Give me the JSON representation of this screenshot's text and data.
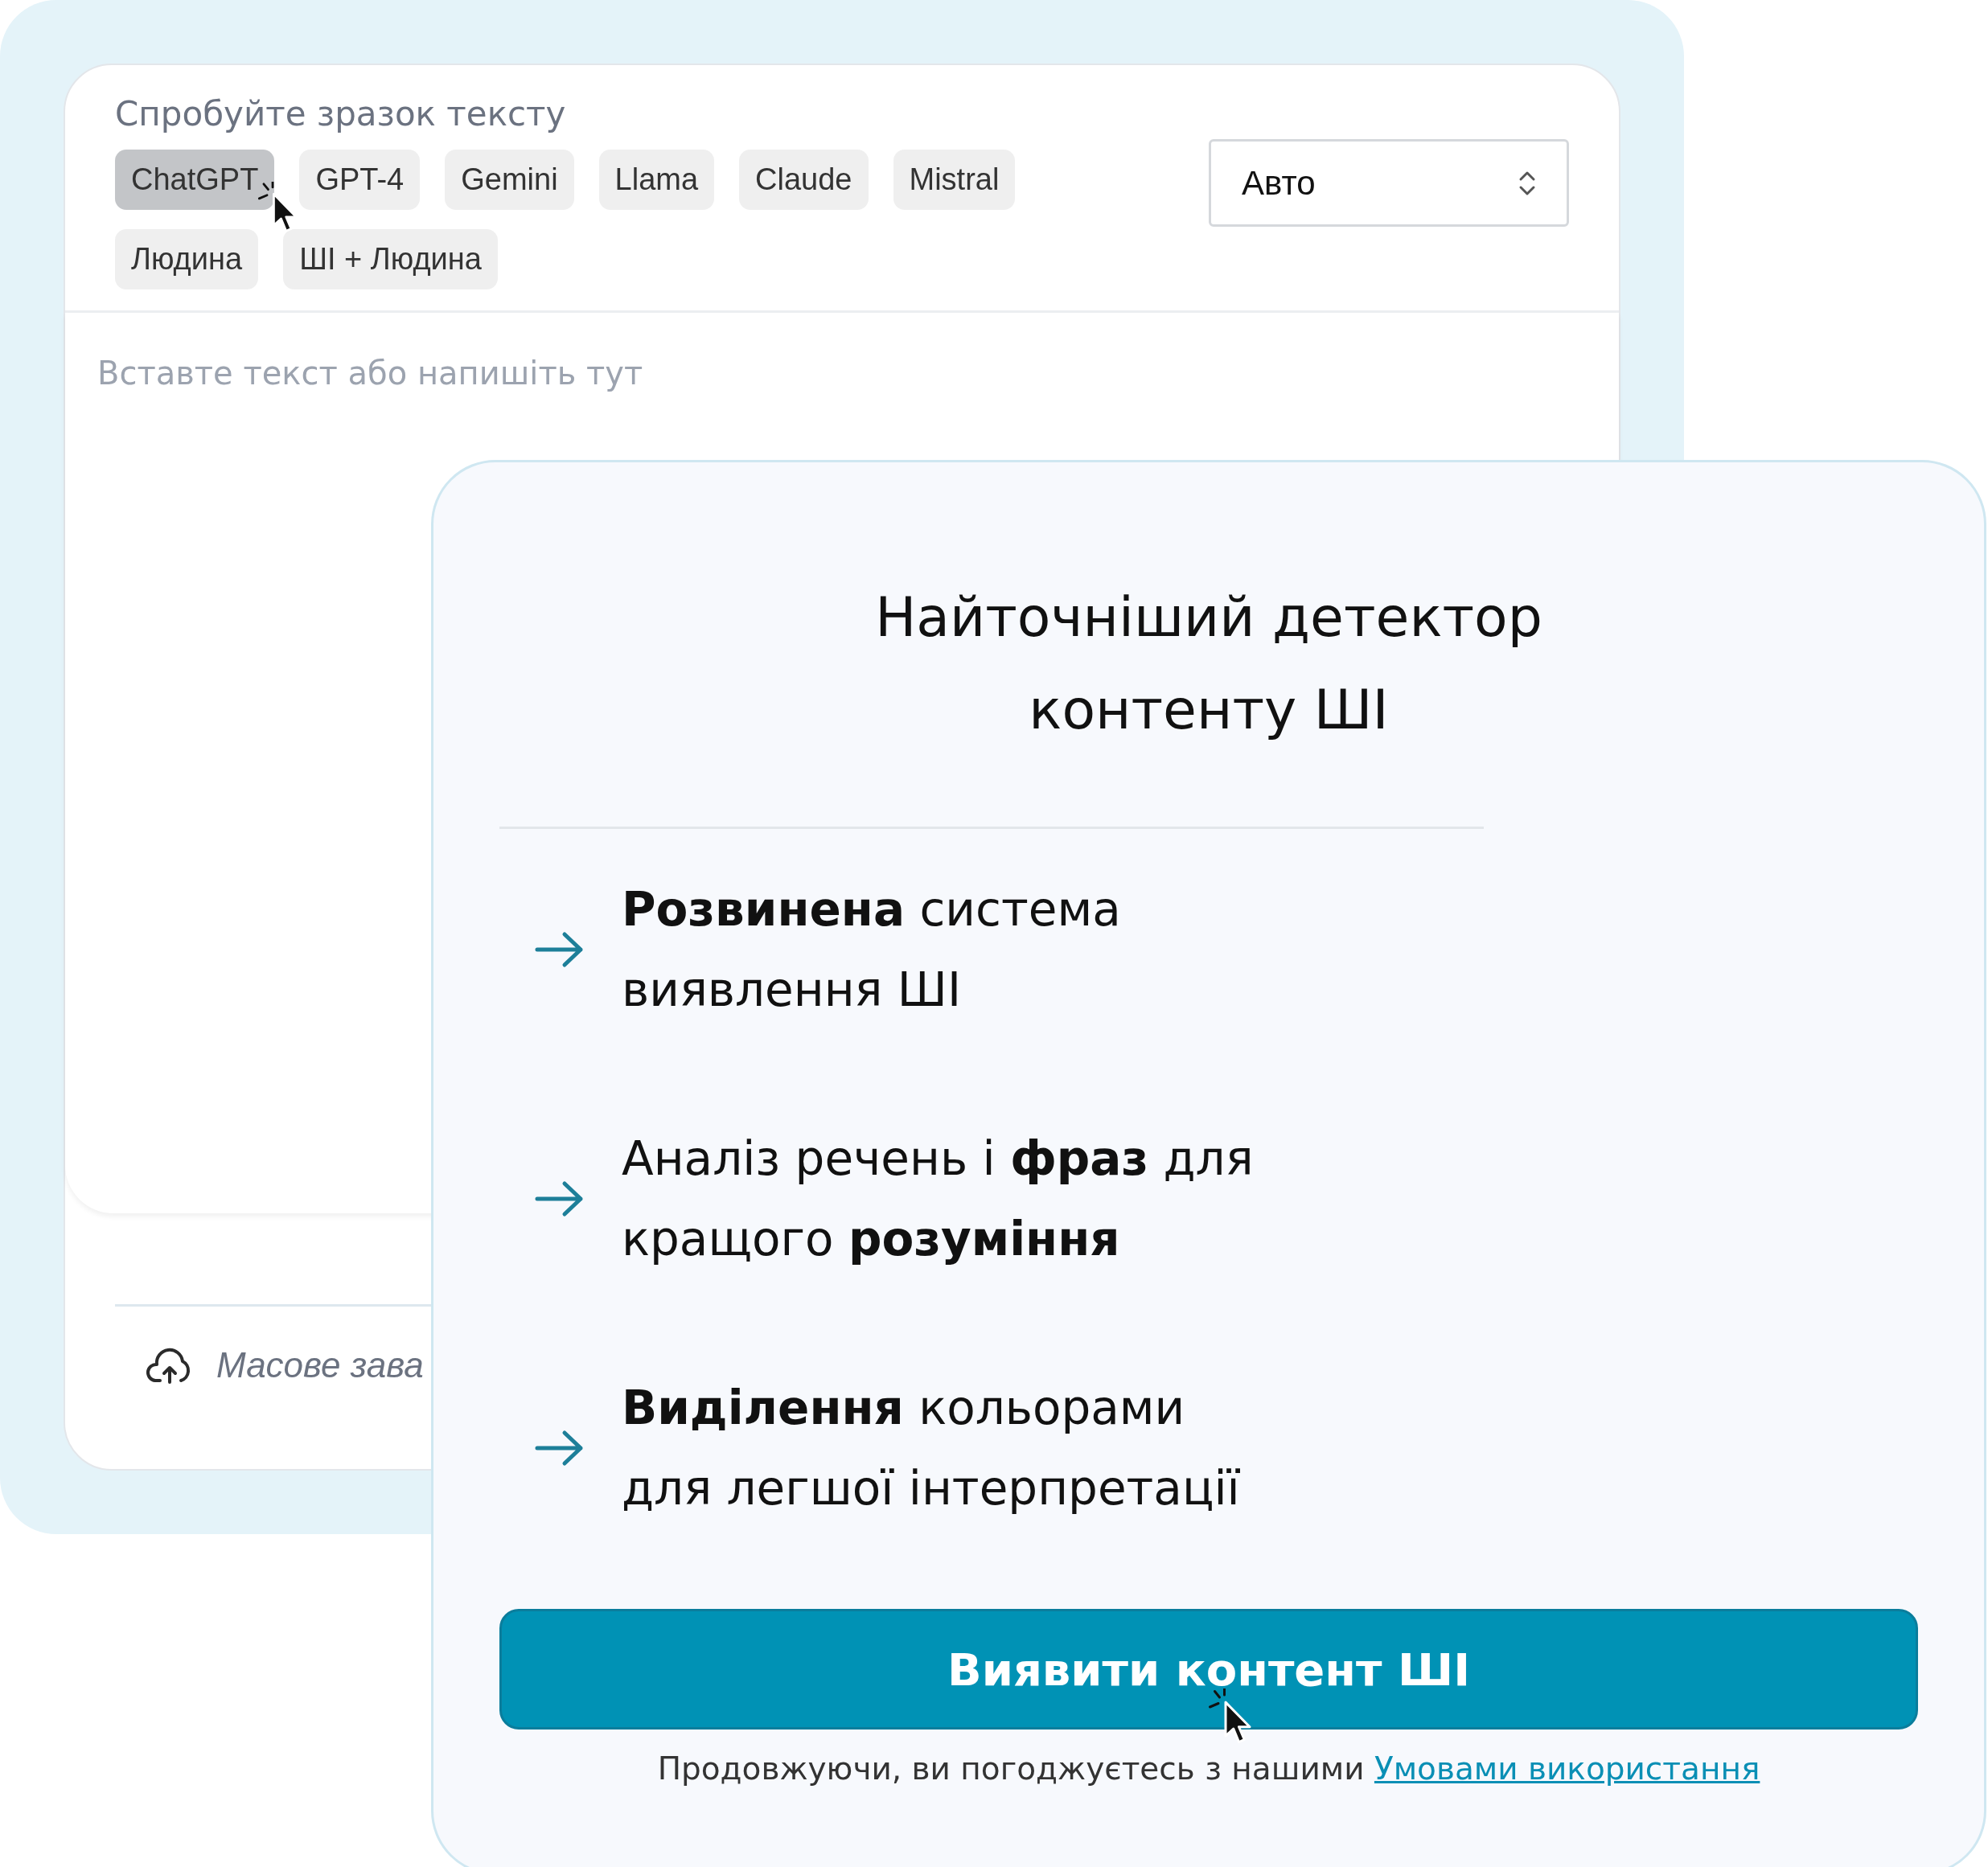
{
  "sample": {
    "label": "Спробуйте зразок тексту",
    "chips": [
      {
        "label": "ChatGPT",
        "selected": true
      },
      {
        "label": "GPT-4",
        "selected": false
      },
      {
        "label": "Gemini",
        "selected": false
      },
      {
        "label": "Llama",
        "selected": false
      },
      {
        "label": "Claude",
        "selected": false
      },
      {
        "label": "Mistral",
        "selected": false
      },
      {
        "label": "Людина",
        "selected": false
      },
      {
        "label": "ШІ + Людина",
        "selected": false
      }
    ]
  },
  "language_select": {
    "value": "Авто"
  },
  "editor": {
    "placeholder": "Вставте текст або напишіть тут"
  },
  "upload": {
    "label": "Масове зава"
  },
  "promo": {
    "title": "Найточніший детектор контенту ШІ",
    "features": [
      "**Розвинена** система виявлення ШІ",
      "Аналіз речень і **фраз** для кращого **розуміння**",
      "**Виділення** кольорами для легшої інтерпретації"
    ],
    "button": "Виявити контент ШІ",
    "terms": {
      "text": "Продовжуючи, ви погоджуєтесь з нашими",
      "link": "Умовами використання"
    }
  }
}
